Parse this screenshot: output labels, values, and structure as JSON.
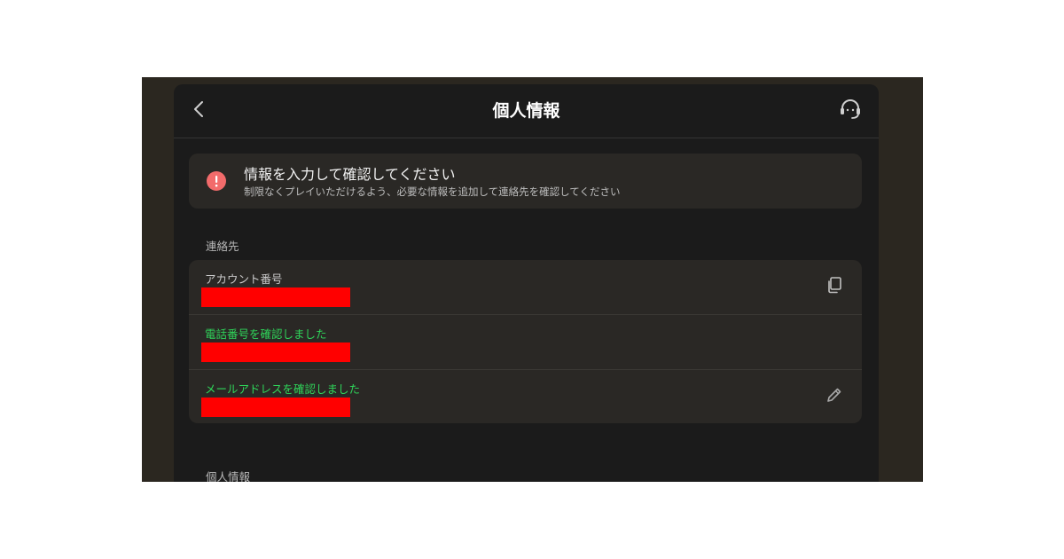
{
  "header": {
    "title": "個人情報",
    "back_icon": "chevron-left-icon",
    "support_icon": "headset-icon"
  },
  "alert": {
    "icon": "alert-circle-icon",
    "icon_color": "#f26b6b",
    "title": "情報を入力して確認してください",
    "subtitle": "制限なくプレイいただけるよう、必要な情報を追加して連絡先を確認してください"
  },
  "contact_section": {
    "label": "連絡先",
    "rows": [
      {
        "label": "アカウント番号",
        "action_icon": "copy-icon"
      },
      {
        "label": "電話番号を確認しました"
      },
      {
        "label": "メールアドレスを確認しました",
        "action_icon": "pencil-icon"
      }
    ]
  },
  "personal_section": {
    "label": "個人情報"
  },
  "colors": {
    "accent_verified": "#2fd55a",
    "redaction": "#ff0000",
    "panel_bg": "#1b1b1b",
    "card_bg": "#2a2825"
  }
}
